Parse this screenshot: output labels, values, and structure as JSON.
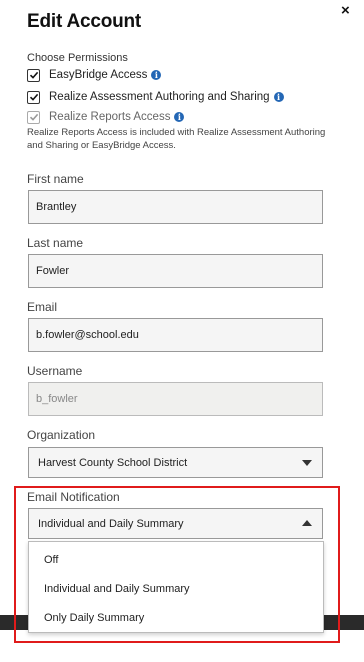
{
  "header": {
    "title": "Edit Account",
    "close_glyph": "×"
  },
  "permissions": {
    "label": "Choose Permissions",
    "items": [
      {
        "label": "EasyBridge Access",
        "checked": true,
        "disabled": false
      },
      {
        "label": "Realize Assessment Authoring and Sharing",
        "checked": true,
        "disabled": false
      },
      {
        "label": "Realize Reports Access",
        "checked": true,
        "disabled": true
      }
    ],
    "note": "Realize Reports Access is included with Realize Assessment Authoring and Sharing or EasyBridge Access."
  },
  "form": {
    "first_name": {
      "label": "First name",
      "value": "Brantley"
    },
    "last_name": {
      "label": "Last name",
      "value": "Fowler"
    },
    "email": {
      "label": "Email",
      "value": "b.fowler@school.edu"
    },
    "username": {
      "label": "Username",
      "value": "b_fowler"
    },
    "organization": {
      "label": "Organization",
      "value": "Harvest County School District"
    },
    "email_notification": {
      "label": "Email Notification",
      "value": "Individual and Daily Summary",
      "options": [
        "Off",
        "Individual and Daily Summary",
        "Only Daily Summary"
      ]
    }
  },
  "icons": {
    "info": "i",
    "checkbox": "check-icon",
    "caret": "caret-icon"
  },
  "colors": {
    "info_blue": "#2467b5",
    "highlight_red": "#e01b1b",
    "footer_bar": "#2a2a2a"
  }
}
